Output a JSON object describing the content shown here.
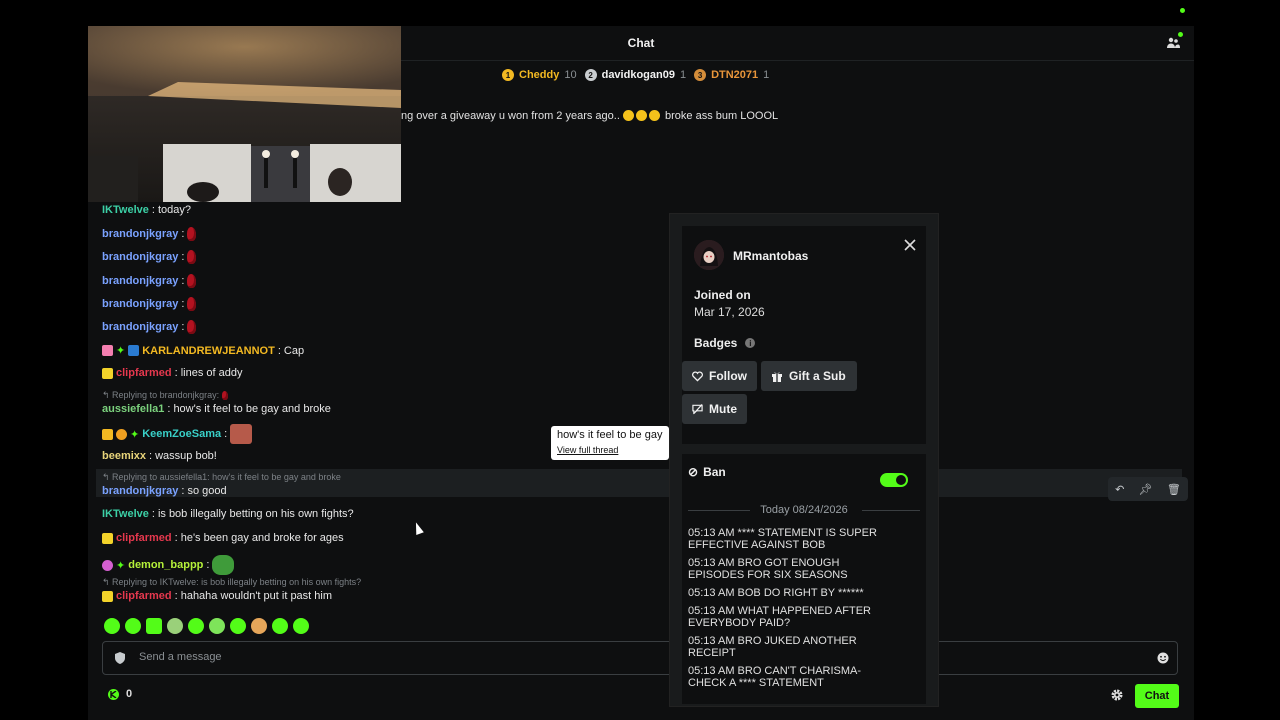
{
  "header": {
    "title": "Chat"
  },
  "leaderboard": [
    {
      "rank": "1",
      "name": "Cheddy",
      "count": "10",
      "rank_color": "#f3b922",
      "name_color": "#f3b922"
    },
    {
      "rank": "2",
      "name": "davidkogan09",
      "count": "1",
      "rank_color": "#c9cdd0",
      "name_color": "#f2f2f2"
    },
    {
      "rank": "3",
      "name": "DTN2071",
      "count": "1",
      "rank_color": "#d48d3a",
      "name_color": "#e8953a"
    }
  ],
  "pinned": {
    "text_before": "ng over a giveaway u won from 2 years ago..",
    "text_after": "broke ass bum LOOOL"
  },
  "messages": [
    {
      "user": "IKTwelve",
      "color": "#3cd0a6",
      "text": "today?"
    },
    {
      "user": "brandonjkgray",
      "color": "#7aa2ff"
    },
    {
      "user": "brandonjkgray",
      "color": "#7aa2ff"
    },
    {
      "user": "brandonjkgray",
      "color": "#7aa2ff"
    },
    {
      "user": "brandonjkgray",
      "color": "#7aa2ff"
    },
    {
      "user": "brandonjkgray",
      "color": "#7aa2ff"
    },
    {
      "user": "KARLANDREWJEANNOT",
      "color": "#f3b922",
      "text": "Cap"
    },
    {
      "user": "clipfarmed",
      "color": "#e5384e",
      "text": "lines of addy"
    },
    {
      "reply": "Replying to brandonjkgray:",
      "user": "aussiefella1",
      "color": "#7bd17d",
      "text": "how's it feel to be gay and broke"
    },
    {
      "user": "KeemZoeSama",
      "color": "#39d0c8"
    },
    {
      "user": "beemixx",
      "color": "#e8d47a",
      "text": "wassup bob!"
    },
    {
      "reply": "Replying to aussiefella1: how's it feel to be gay and broke",
      "user": "brandonjkgray",
      "color": "#7aa2ff",
      "text": "so good"
    },
    {
      "user": "IKTwelve",
      "color": "#3cd0a6",
      "text": "is bob illegally betting on his own fights?"
    },
    {
      "user": "clipfarmed",
      "color": "#e5384e",
      "text": "he's been gay and broke for ages"
    },
    {
      "user": "demon_bappp",
      "color": "#b6f23a"
    },
    {
      "reply": "Replying to IKTwelve: is bob illegally betting on his own fights?",
      "user": "clipfarmed",
      "color": "#e5384e",
      "text": "hahaha wouldn't put it past him"
    }
  ],
  "tooltip": {
    "text": "how's it feel to be gay",
    "link": "View full thread"
  },
  "input": {
    "placeholder": "Send a message"
  },
  "points": {
    "value": "0"
  },
  "chat_button": "Chat",
  "card": {
    "username": "MRmantobas",
    "joined_label": "Joined on",
    "joined_date": "Mar 17, 2026",
    "badges_label": "Badges",
    "follow": "Follow",
    "gift": "Gift a Sub",
    "mute": "Mute",
    "ban": "Ban",
    "date_label": "Today 08/24/2026",
    "history": [
      "05:13 AM **** STATEMENT IS SUPER EFFECTIVE AGAINST BOB",
      "05:13 AM BRO GOT ENOUGH EPISODES FOR SIX SEASONS",
      "05:13 AM BOB DO RIGHT BY ******",
      "05:13 AM WHAT HAPPENED AFTER EVERYBODY PAID?",
      "05:13 AM BRO JUKED ANOTHER RECEIPT",
      "05:13 AM BRO CAN'T CHARISMA-CHECK A **** STATEMENT"
    ]
  },
  "colors": {
    "accent": "#53fc18",
    "background": "#0e0f10",
    "panel": "#191b1c"
  }
}
